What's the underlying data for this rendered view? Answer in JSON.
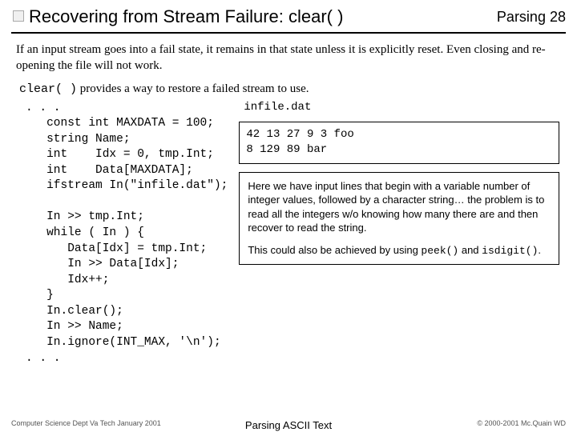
{
  "header": {
    "title": "Recovering from Stream Failure:  clear( )",
    "section": "Parsing",
    "page": "28"
  },
  "intro": "If an input stream goes into a fail state, it remains in that state unless it is explicitly reset. Even closing and re-opening the file will not work.",
  "lead": {
    "code": "clear( )",
    "rest": " provides a way to restore a failed stream to use."
  },
  "code": ". . .\n   const int MAXDATA = 100;\n   string Name;\n   int    Idx = 0, tmp.Int;\n   int    Data[MAXDATA];\n   ifstream In(\"infile.dat\");\n\n   In >> tmp.Int;\n   while ( In ) {\n      Data[Idx] = tmp.Int;\n      In >> Data[Idx];\n      Idx++;\n   }\n   In.clear();\n   In >> Name;\n   In.ignore(INT_MAX, '\\n');\n. . .",
  "file": {
    "name": "infile.dat",
    "contents": "42 13 27 9 3 foo\n8 129 89 bar"
  },
  "note": {
    "p1": "Here we have input lines that begin with a variable number of integer values, followed by a character string… the problem is to read all the integers w/o knowing how many there are and then recover to read the string.",
    "p2a": "This could also be achieved by using ",
    "p2b": "peek()",
    "p2c": " and ",
    "p2d": "isdigit()",
    "p2e": "."
  },
  "footer": {
    "left": "Computer Science Dept Va Tech January 2001",
    "center": "Parsing ASCII Text",
    "right": "© 2000-2001  Mc.Quain WD"
  }
}
